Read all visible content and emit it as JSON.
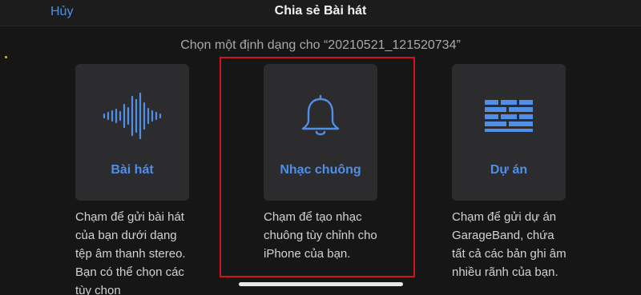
{
  "navbar": {
    "cancel_label": "Hủy",
    "title": "Chia sẻ Bài hát"
  },
  "prompt": "Chọn một định dạng cho “20210521_121520734”",
  "options": [
    {
      "label": "Bài hát",
      "icon": "waveform-icon",
      "description": "Chạm để gửi bài hát của bạn dưới dạng tệp âm thanh stereo. Bạn có thể chọn các tùy chọn"
    },
    {
      "label": "Nhạc chuông",
      "icon": "bell-icon",
      "description": "Chạm để tạo nhạc chuông tùy chỉnh cho iPhone của bạn."
    },
    {
      "label": "Dự án",
      "icon": "brick-wall-icon",
      "description": "Chạm để gửi dự án GarageBand, chứa tất cả các bản ghi âm nhiều rãnh của bạn."
    }
  ],
  "colors": {
    "accent": "#4f8fe8",
    "background": "#161616",
    "tile": "#2c2c2e",
    "highlight": "#d3121b"
  }
}
